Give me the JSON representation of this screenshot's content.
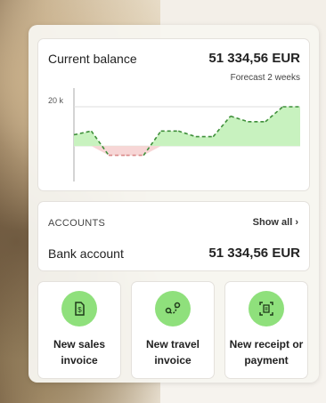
{
  "balance": {
    "title": "Current balance",
    "amount": "51 334,56 EUR",
    "forecast_label": "Forecast 2 weeks",
    "y_tick": "20 k"
  },
  "chart_data": {
    "type": "line",
    "x": [
      0,
      1,
      2,
      3,
      4,
      5,
      6,
      7,
      8,
      9,
      10,
      11,
      12,
      13,
      14
    ],
    "values": [
      12.5,
      13.5,
      7.0,
      7.0,
      7.0,
      13.5,
      13.5,
      12.0,
      12.0,
      17.5,
      16.0,
      16.0,
      20.0,
      20.0
    ],
    "ytick_labels": [
      "20 k"
    ],
    "positive_color": "#c8f2bf",
    "negative_color": "#f7d6d6",
    "line_color": "#3f8f3a",
    "negative_line_color": "#d98888"
  },
  "accounts": {
    "label": "ACCOUNTS",
    "show_all": "Show all",
    "items": [
      {
        "name": "Bank account",
        "amount": "51 334,56 EUR"
      }
    ]
  },
  "actions": [
    {
      "label": "New sales invoice",
      "icon": "dollar-doc-icon"
    },
    {
      "label": "New travel invoice",
      "icon": "route-icon"
    },
    {
      "label": "New receipt or payment",
      "icon": "receipt-scan-icon"
    }
  ]
}
